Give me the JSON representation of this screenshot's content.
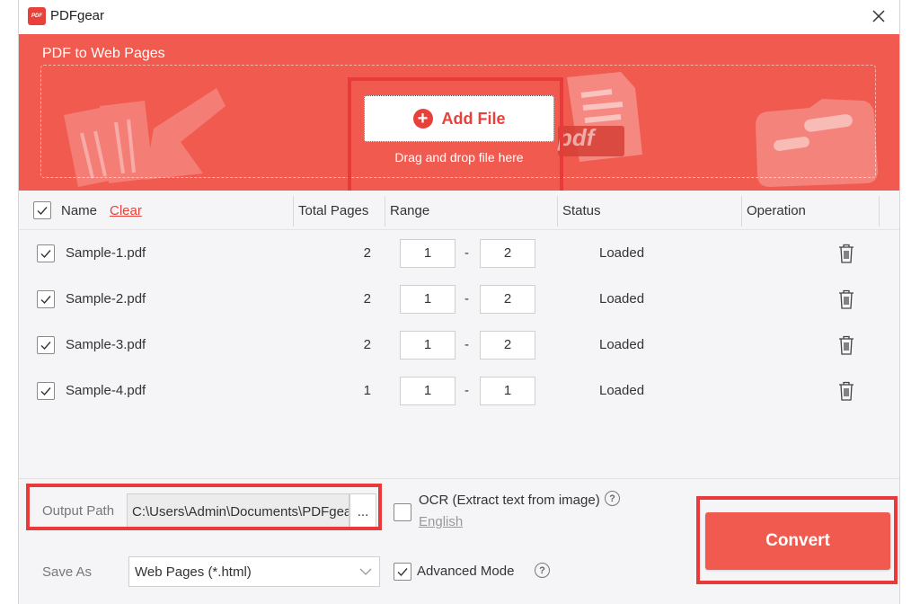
{
  "app": {
    "title": "PDFgear",
    "logo_text": "PDF"
  },
  "hero": {
    "title": "PDF to Web Pages",
    "add_file_label": "Add File",
    "drag_hint": "Drag and drop file here",
    "deco_text": "pdf"
  },
  "table": {
    "headers": {
      "name": "Name",
      "clear": "Clear",
      "total_pages": "Total Pages",
      "range": "Range",
      "status": "Status",
      "operation": "Operation"
    },
    "range_separator": "-",
    "rows": [
      {
        "name": "Sample-1.pdf",
        "total_pages": "2",
        "range_from": "1",
        "range_to": "2",
        "status": "Loaded"
      },
      {
        "name": "Sample-2.pdf",
        "total_pages": "2",
        "range_from": "1",
        "range_to": "2",
        "status": "Loaded"
      },
      {
        "name": "Sample-3.pdf",
        "total_pages": "2",
        "range_from": "1",
        "range_to": "2",
        "status": "Loaded"
      },
      {
        "name": "Sample-4.pdf",
        "total_pages": "1",
        "range_from": "1",
        "range_to": "1",
        "status": "Loaded"
      }
    ]
  },
  "footer": {
    "output_path_label": "Output Path",
    "output_path_value": "C:\\Users\\Admin\\Documents\\PDFgear",
    "browse_label": "...",
    "ocr_label": "OCR (Extract text from image)",
    "ocr_language": "English",
    "help_glyph": "?",
    "save_as_label": "Save As",
    "save_as_value": "Web Pages (*.html)",
    "advanced_mode_label": "Advanced Mode",
    "convert_label": "Convert"
  },
  "colors": {
    "brand": "#f15a4f",
    "highlight": "#e83a3a",
    "link_red": "#e8413a"
  }
}
